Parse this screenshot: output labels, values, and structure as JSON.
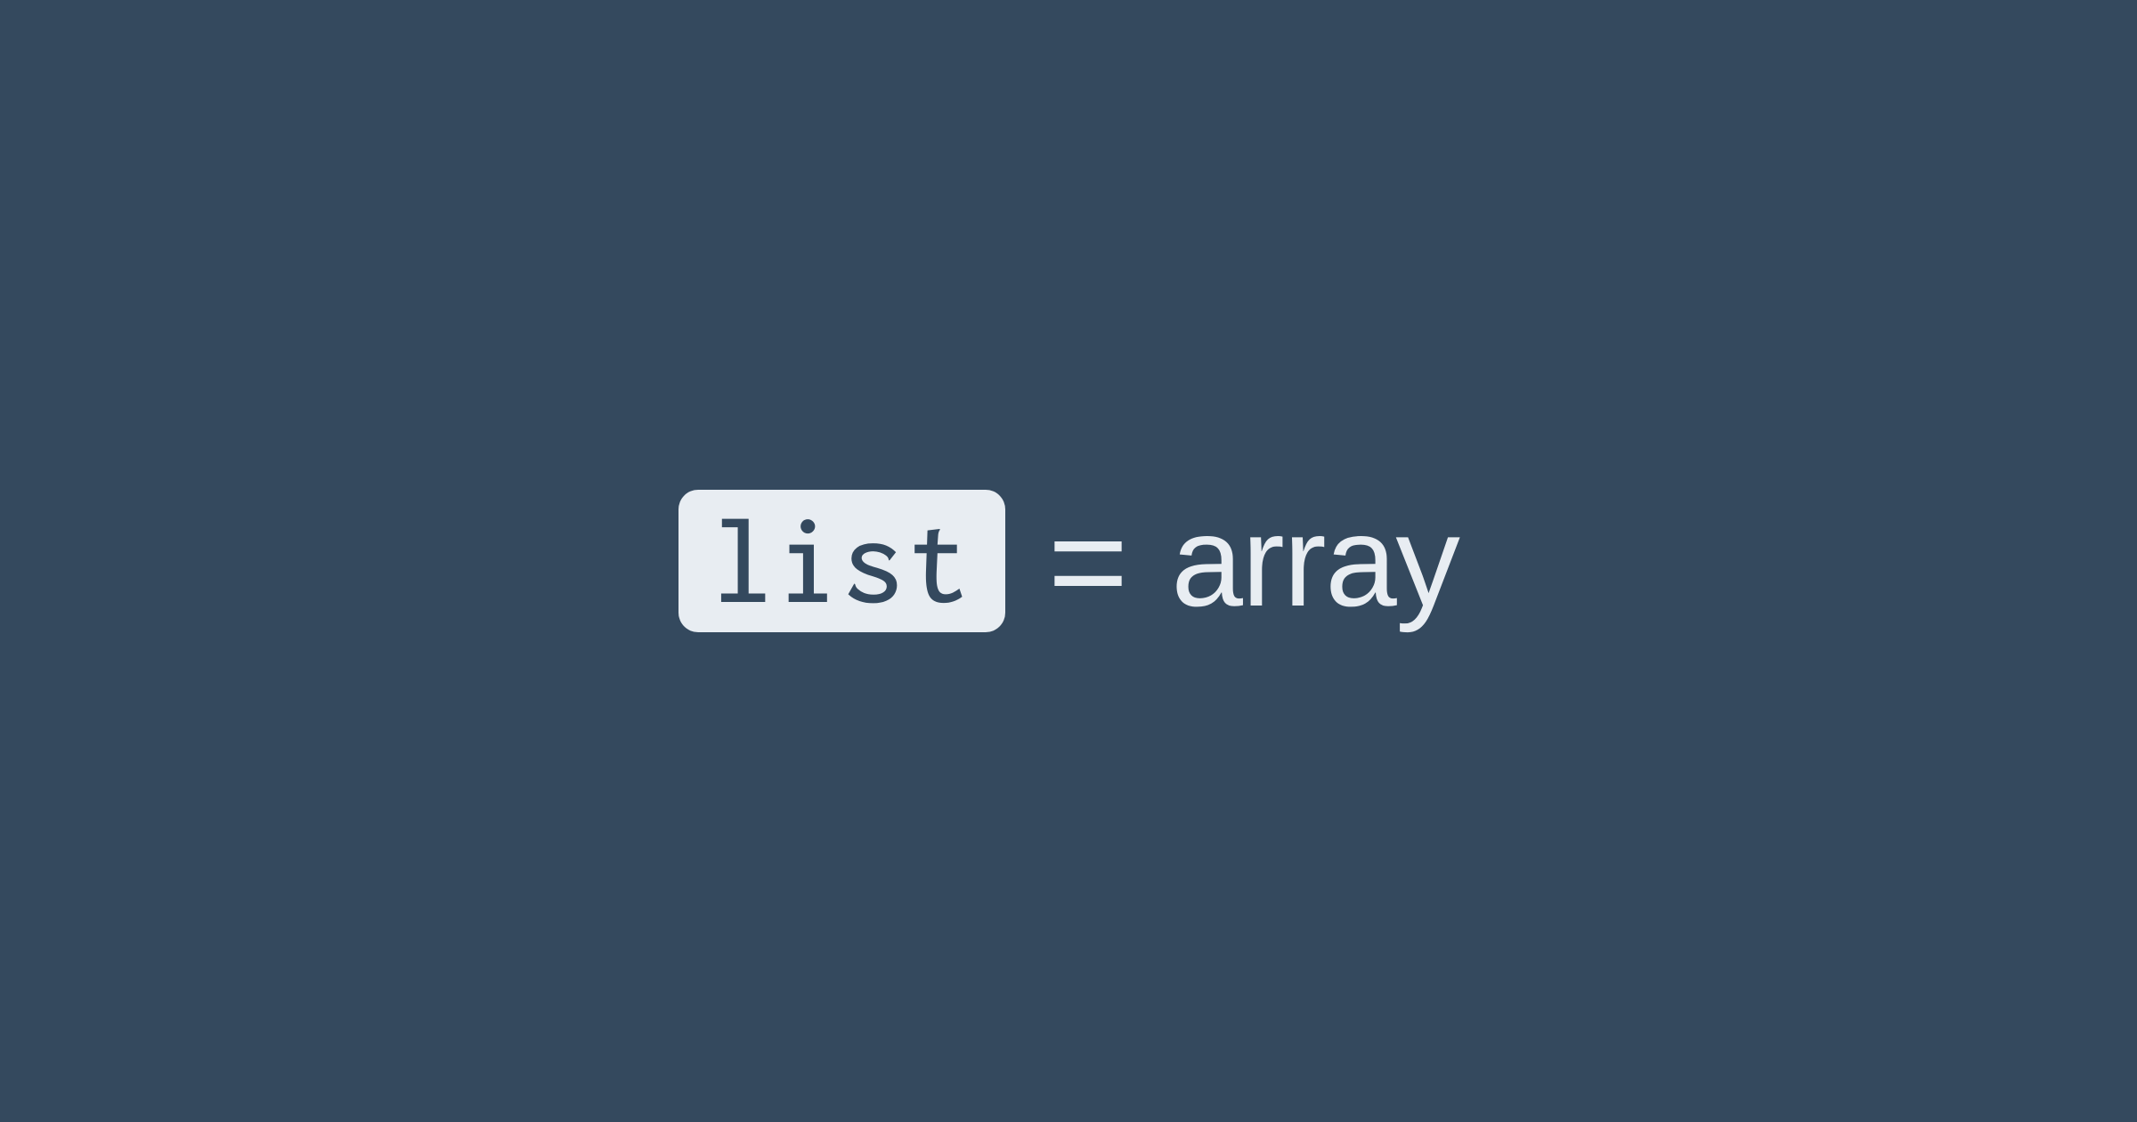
{
  "left_term": "list",
  "operator": "=",
  "right_term": "array"
}
